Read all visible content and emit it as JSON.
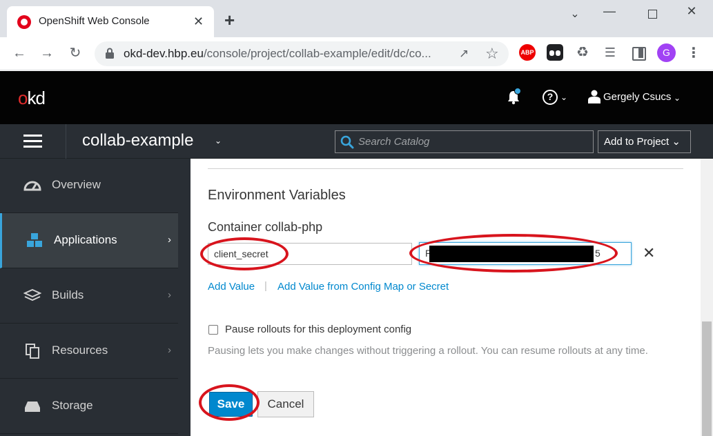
{
  "browser": {
    "tab_title": "OpenShift Web Console",
    "tab_close": "✕",
    "new_tab": "+",
    "url_host": "okd-dev.hbp.eu",
    "url_path": "/console/project/collab-example/edit/dc/co...",
    "profile_initial": "G",
    "abp_label": "ABP"
  },
  "header": {
    "logo_o": "o",
    "logo_rest": "kd",
    "user_name": "Gergely Csucs",
    "help_glyph": "?"
  },
  "project_bar": {
    "project_name": "collab-example",
    "search_placeholder": "Search Catalog",
    "add_to_project": "Add to Project"
  },
  "sidebar": {
    "items": [
      {
        "label": "Overview",
        "icon": "dashboard-icon",
        "active": false
      },
      {
        "label": "Applications",
        "icon": "cubes-icon",
        "active": true
      },
      {
        "label": "Builds",
        "icon": "layers-icon",
        "active": false
      },
      {
        "label": "Resources",
        "icon": "files-icon",
        "active": false
      },
      {
        "label": "Storage",
        "icon": "hdd-icon",
        "active": false
      }
    ]
  },
  "main": {
    "section_title": "Environment Variables",
    "container_title": "Container collab-php",
    "env": {
      "name": "client_secret",
      "value_prefix": "P",
      "value_suffix": "5"
    },
    "remove_glyph": "✕",
    "add_value": "Add Value",
    "link_separator": "|",
    "add_from_config": "Add Value from Config Map or Secret",
    "pause_label": "Pause rollouts for this deployment config",
    "pause_help": "Pausing lets you make changes without triggering a rollout. You can resume rollouts at any time.",
    "save": "Save",
    "cancel": "Cancel"
  },
  "colors": {
    "header_bg": "#030303",
    "nav_bg": "#292e34",
    "accent": "#0088ce",
    "annotation": "#d8141d"
  }
}
